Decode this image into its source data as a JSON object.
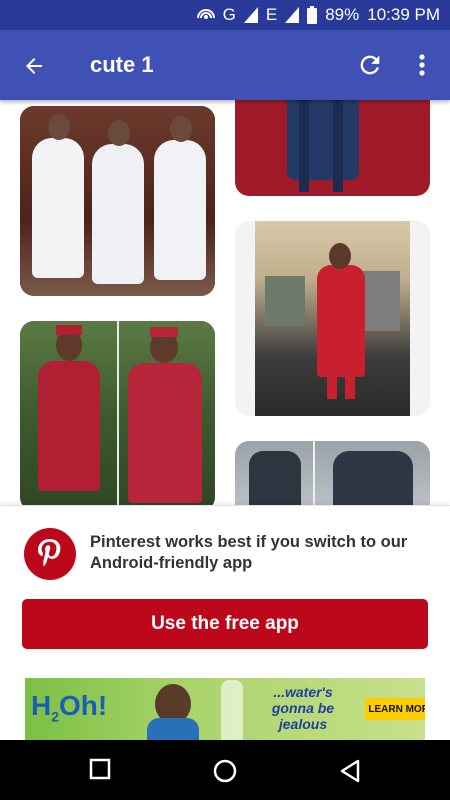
{
  "status_bar": {
    "network": "G",
    "signal_label": "E",
    "battery": "89%",
    "time": "10:39 PM"
  },
  "app_bar": {
    "title": "cute 1",
    "back_icon": "arrow-back-icon",
    "refresh_icon": "refresh-icon",
    "more_icon": "more-vert-icon"
  },
  "pins": [
    {
      "id": "pin-1",
      "description": "three men in white agbada"
    },
    {
      "id": "pin-2",
      "description": "man in navy outfit on red carpet"
    },
    {
      "id": "pin-3",
      "description": "man in red agbada in airport"
    },
    {
      "id": "pin-4",
      "description": "two men in red agbada with caps"
    },
    {
      "id": "pin-5",
      "description": "men in dark agbada near cars"
    }
  ],
  "banner": {
    "message": "Pinterest works best if you switch to our Android-friendly app",
    "cta_label": "Use the free app",
    "brand_color": "#bd081c"
  },
  "ad": {
    "brand_h": "H",
    "brand_2": "2",
    "brand_oh": "Oh!",
    "tagline": "...water's gonna be jealous",
    "learn_more": "LEARN MORE"
  },
  "nav": {
    "recents_icon": "square-recents-icon",
    "home_icon": "circle-home-icon",
    "back_icon": "triangle-back-icon"
  }
}
